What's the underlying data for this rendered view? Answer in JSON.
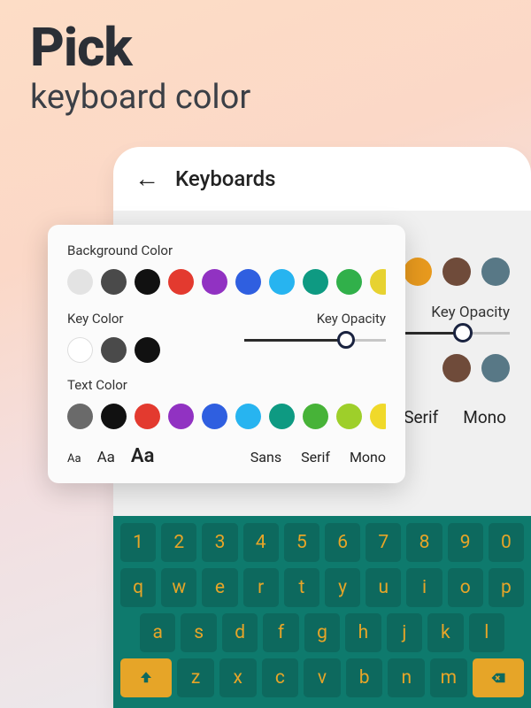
{
  "hero": {
    "title": "Pick",
    "subtitle": "keyboard color"
  },
  "phone": {
    "back_icon": "←",
    "title": "Keyboards",
    "bg_section_label": "Background Color",
    "bg_visible_swatches": [
      "#e89a1e",
      "#6f4b3a",
      "#587886"
    ],
    "opacity_label": "Key Opacity",
    "opacity_value": 0.72,
    "text_visible_swatches": [
      "#6f4b3a",
      "#587886"
    ],
    "font_families": [
      "Serif",
      "Mono"
    ]
  },
  "popup": {
    "bg_label": "Background Color",
    "bg_swatches": [
      "#e3e3e3",
      "#4a4a4a",
      "#111111",
      "#e33a2f",
      "#9132c2",
      "#2f5fe0",
      "#27b4f0",
      "#0e9a82",
      "#31b04a",
      "#e7d230"
    ],
    "key_label": "Key Color",
    "key_swatches": [
      "#ffffff",
      "#4a4a4a",
      "#111111"
    ],
    "opacity_label": "Key Opacity",
    "opacity_value": 0.72,
    "text_label": "Text Color",
    "text_swatches": [
      "#6a6a6a",
      "#111111",
      "#e33a2f",
      "#9132c2",
      "#2f5fe0",
      "#27b4f0",
      "#0e9a82",
      "#47b338",
      "#9ecf2a",
      "#f0d92a"
    ],
    "font_sizes": [
      "Aa",
      "Aa",
      "Aa"
    ],
    "font_families": [
      "Sans",
      "Serif",
      "Mono"
    ]
  },
  "keyboard": {
    "bg": "#0e7a6d",
    "key_bg": "#0d695e",
    "key_fg": "#e6a528",
    "rows": [
      [
        "1",
        "2",
        "3",
        "4",
        "5",
        "6",
        "7",
        "8",
        "9",
        "0"
      ],
      [
        "q",
        "w",
        "e",
        "r",
        "t",
        "y",
        "u",
        "i",
        "o",
        "p"
      ],
      [
        "a",
        "s",
        "d",
        "f",
        "g",
        "h",
        "j",
        "k",
        "l"
      ],
      [
        "shift",
        "z",
        "x",
        "c",
        "v",
        "b",
        "n",
        "m",
        "backspace"
      ]
    ]
  }
}
